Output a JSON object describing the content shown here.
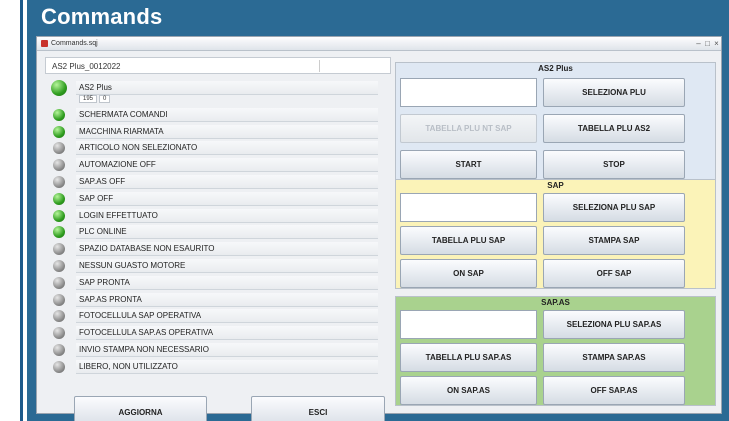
{
  "banner": {
    "title": "Commands"
  },
  "window": {
    "title": "Commands.sqj",
    "controls": [
      "minimize-icon",
      "maximize-icon",
      "close-icon"
    ]
  },
  "left": {
    "model": "AS2 Plus_0012022",
    "counter": [
      "195",
      "0"
    ],
    "statuses": [
      {
        "label": "AS2 Plus",
        "color": "green",
        "big": true
      },
      {
        "label": "SCHERMATA COMANDI",
        "color": "green"
      },
      {
        "label": "MACCHINA RIARMATA",
        "color": "green"
      },
      {
        "label": "ARTICOLO NON SELEZIONATO",
        "color": "grey"
      },
      {
        "label": "AUTOMAZIONE OFF",
        "color": "grey"
      },
      {
        "label": "SAP.AS OFF",
        "color": "grey"
      },
      {
        "label": "SAP OFF",
        "color": "green"
      },
      {
        "label": "LOGIN EFFETTUATO",
        "color": "green"
      },
      {
        "label": "PLC ONLINE",
        "color": "green"
      },
      {
        "label": "SPAZIO DATABASE NON ESAURITO",
        "color": "grey"
      },
      {
        "label": "NESSUN GUASTO MOTORE",
        "color": "grey"
      },
      {
        "label": "SAP PRONTA",
        "color": "grey"
      },
      {
        "label": "SAP.AS PRONTA",
        "color": "grey"
      },
      {
        "label": "FOTOCELLULA SAP OPERATIVA",
        "color": "grey"
      },
      {
        "label": "FOTOCELLULA SAP.AS OPERATIVA",
        "color": "grey"
      },
      {
        "label": "INVIO STAMPA NON NECESSARIO",
        "color": "grey"
      },
      {
        "label": "LIBERO, NON UTILIZZATO",
        "color": "grey"
      }
    ],
    "buttons": {
      "refresh": "AGGIORNA",
      "exit": "ESCI"
    }
  },
  "groups": {
    "as2": {
      "title": "AS2 Plus",
      "color": "#dfe8f3",
      "select": "SELEZIONA PLU",
      "table_nt": "TABELLA PLU NT SAP",
      "table": "TABELLA PLU AS2",
      "start": "START",
      "stop": "STOP"
    },
    "sap": {
      "title": "SAP",
      "color": "#fbf3b8",
      "select": "SELEZIONA PLU SAP",
      "table": "TABELLA PLU SAP",
      "print": "STAMPA SAP",
      "on": "ON SAP",
      "off": "OFF SAP"
    },
    "sapas": {
      "title": "SAP.AS",
      "color": "#a9d28e",
      "select": "SELEZIONA PLU SAP.AS",
      "table": "TABELLA PLU SAP.AS",
      "print": "STAMPA SAP.AS",
      "on": "ON SAP.AS",
      "off": "OFF SAP.AS"
    }
  }
}
